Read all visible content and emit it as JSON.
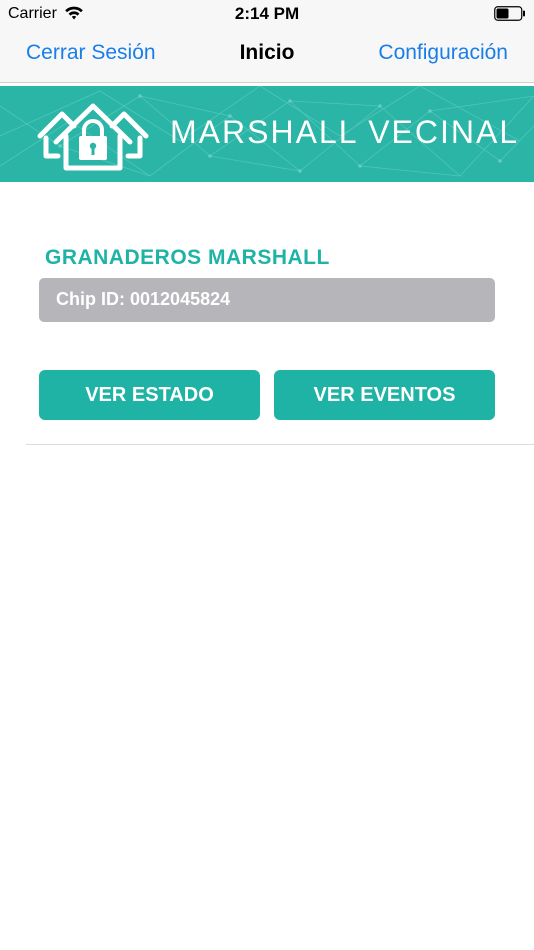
{
  "status_bar": {
    "carrier": "Carrier",
    "time": "2:14 PM",
    "wifi_icon": "wifi-icon",
    "battery_icon": "battery-icon"
  },
  "nav": {
    "left_label": "Cerrar Sesión",
    "title": "Inicio",
    "right_label": "Configuración"
  },
  "banner": {
    "brand_text": "MARSHALL VECINAL",
    "logo_icon": "houses-lock-icon",
    "background_color": "#2ab5a7"
  },
  "group": {
    "name": "GRANADEROS MARSHALL",
    "chip_label": "Chip ID:",
    "chip_id": "0012045824"
  },
  "actions": {
    "status_label": "VER ESTADO",
    "events_label": "VER EVENTOS"
  },
  "colors": {
    "accent": "#1fb3a5",
    "link": "#1a7ee8",
    "chip_bg": "#b5b5ba"
  }
}
